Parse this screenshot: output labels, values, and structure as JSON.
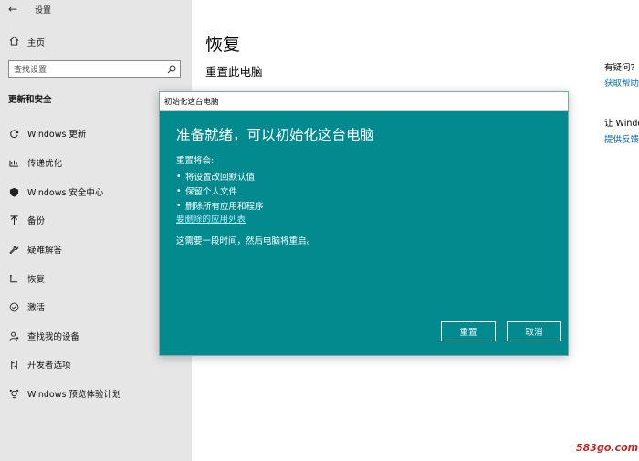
{
  "app": {
    "title": "设置"
  },
  "sidebar": {
    "home_label": "主页",
    "search_placeholder": "查找设置",
    "section_title": "更新和安全",
    "items": [
      {
        "label": "Windows 更新",
        "icon": "refresh-icon"
      },
      {
        "label": "传递优化",
        "icon": "delivery-icon"
      },
      {
        "label": "Windows 安全中心",
        "icon": "shield-icon"
      },
      {
        "label": "备份",
        "icon": "backup-arrow-icon"
      },
      {
        "label": "疑难解答",
        "icon": "wrench-icon"
      },
      {
        "label": "恢复",
        "icon": "recovery-icon"
      },
      {
        "label": "激活",
        "icon": "check-circle-icon"
      },
      {
        "label": "查找我的设备",
        "icon": "person-location-icon"
      },
      {
        "label": "开发者选项",
        "icon": "developer-icon"
      },
      {
        "label": "Windows 预览体验计划",
        "icon": "insider-icon"
      }
    ]
  },
  "main": {
    "title": "恢复",
    "subtitle": "重置此电脑"
  },
  "right_panel": {
    "question": "有疑问?",
    "help_link": "获取帮助",
    "windows_text": "让 Windo",
    "feedback_link": "提供反馈"
  },
  "dialog": {
    "title": "初始化这台电脑",
    "heading": "准备就绪，可以初始化这台电脑",
    "intro": "重置将会:",
    "bullets": [
      "将设置改回默认值",
      "保留个人文件",
      "删除所有应用和程序"
    ],
    "link": "要删除的应用列表",
    "note": "这需要一段时间，然后电脑将重启。",
    "reset_button": "重置",
    "cancel_button": "取消",
    "background_color": "#028a8f"
  },
  "watermark": "583go.com"
}
